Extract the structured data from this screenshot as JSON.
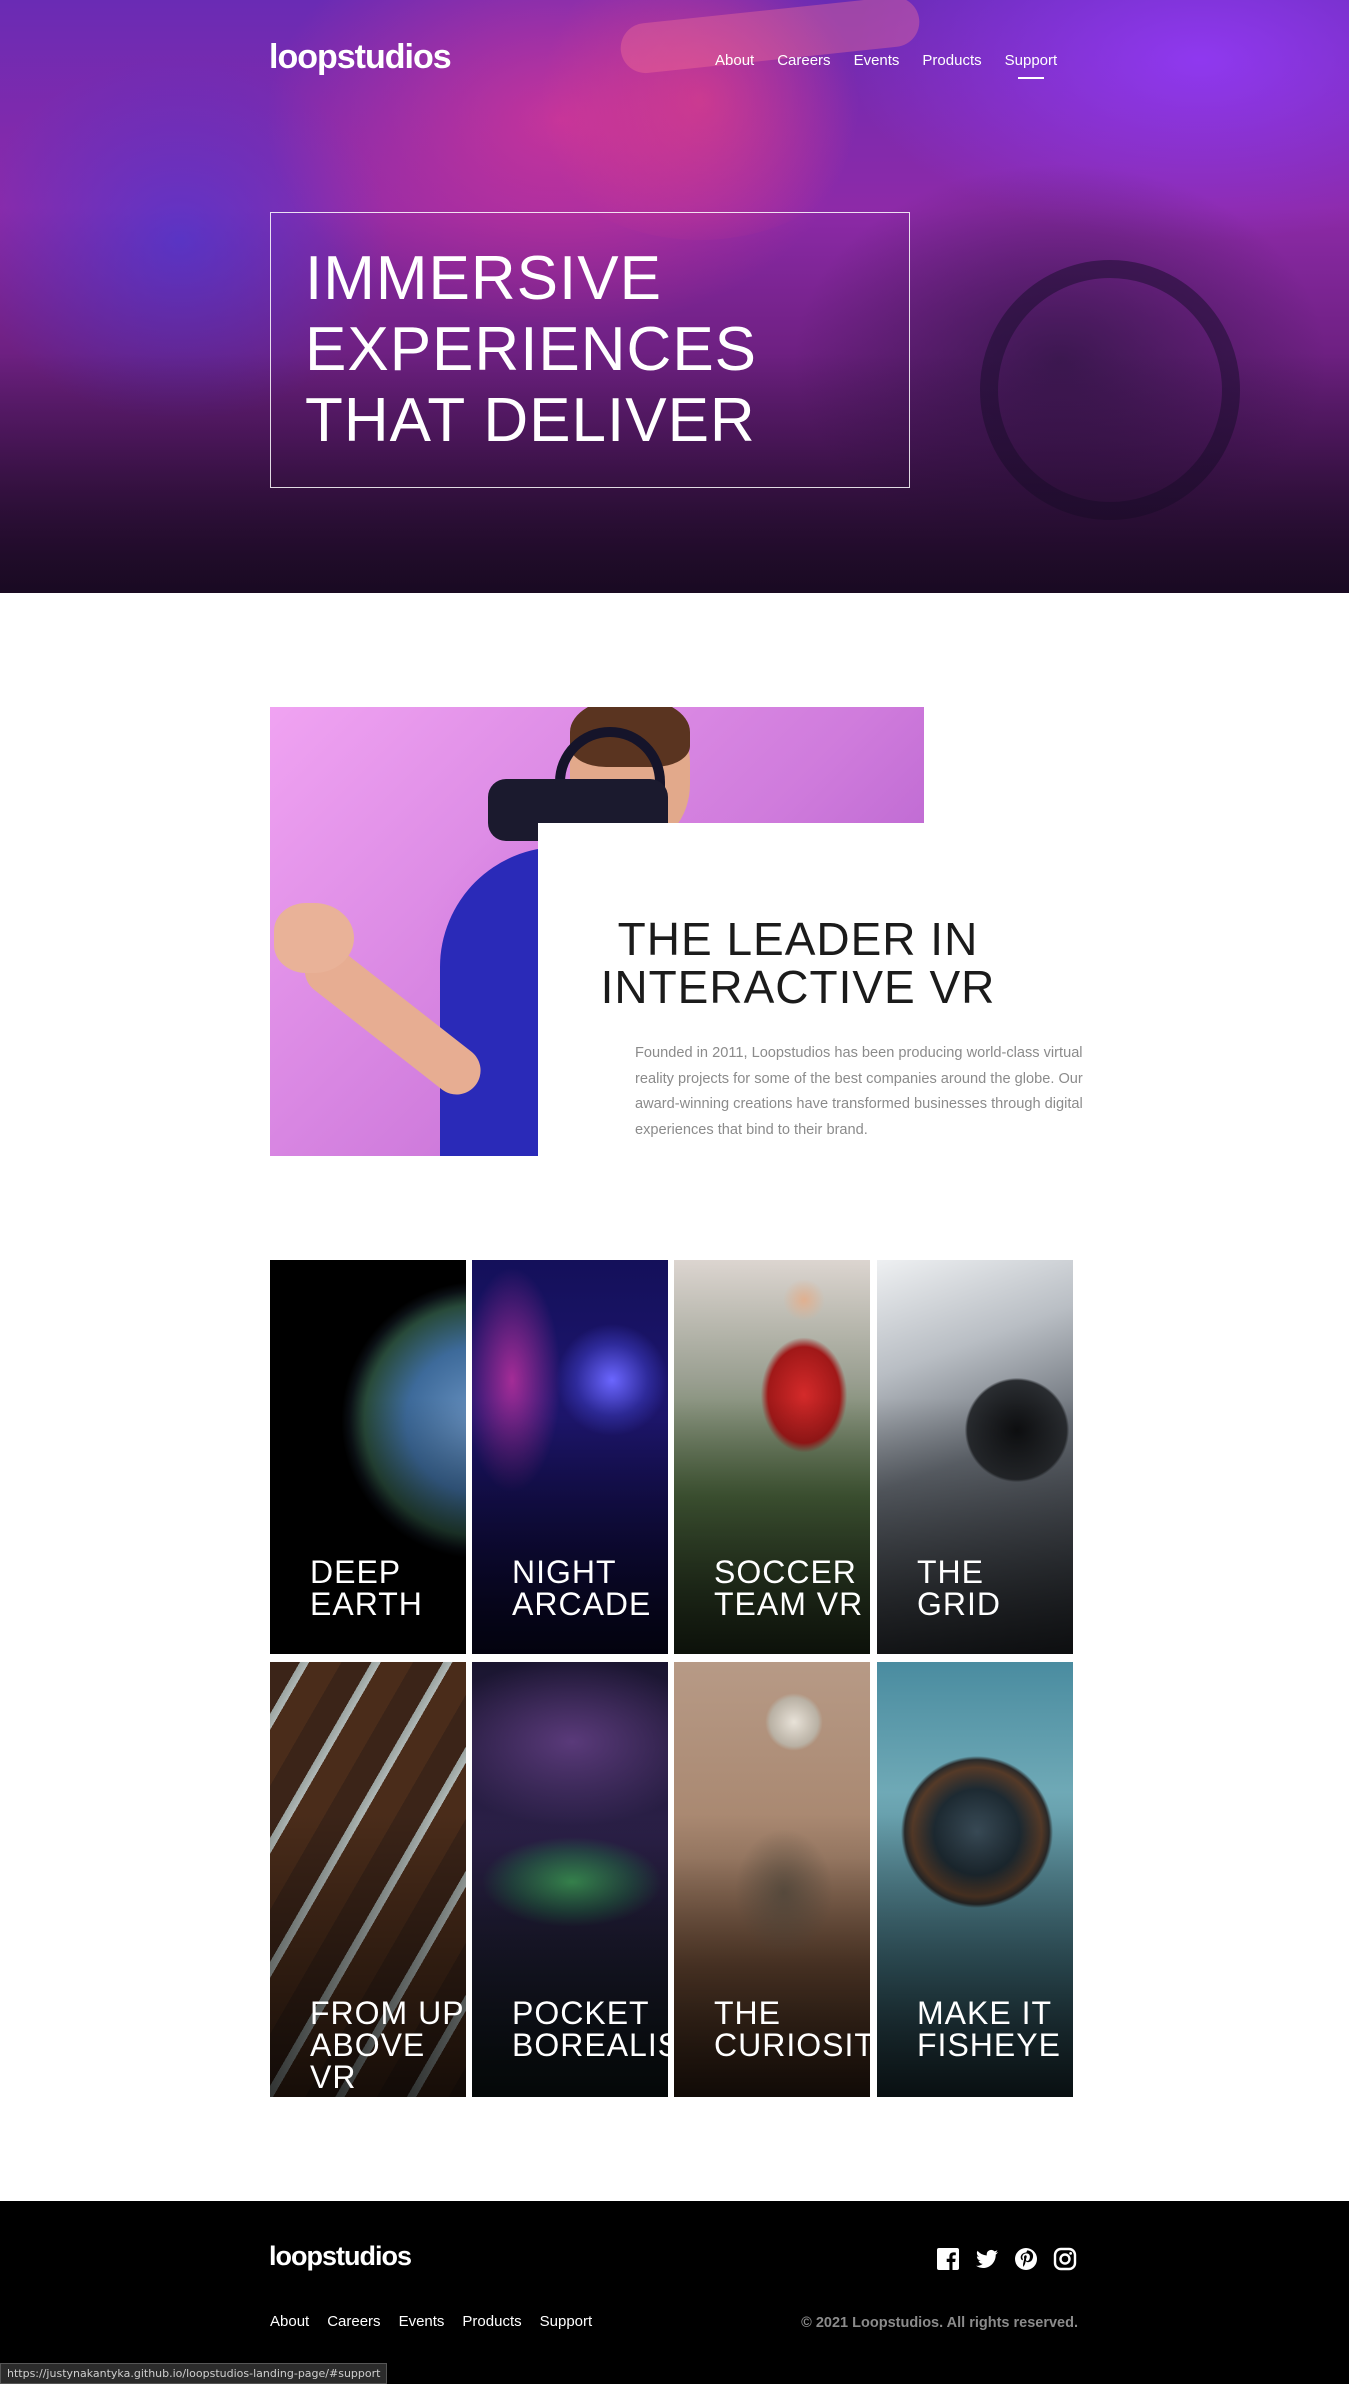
{
  "header": {
    "logo": "loopstudios",
    "nav": [
      "About",
      "Careers",
      "Events",
      "Products",
      "Support"
    ],
    "active_nav": "Support"
  },
  "hero": {
    "headline": [
      "IMMERSIVE",
      "EXPERIENCES",
      "THAT DELIVER"
    ]
  },
  "intro": {
    "heading": [
      "THE LEADER IN",
      "INTERACTIVE VR"
    ],
    "body": "Founded in 2011, Loopstudios has been producing world-class virtual reality projects for some of the best companies around the globe. Our award-winning creations have transformed businesses through digital experiences that bind to their brand."
  },
  "creations": [
    {
      "title": [
        "DEEP",
        "EARTH"
      ]
    },
    {
      "title": [
        "NIGHT",
        "ARCADE"
      ]
    },
    {
      "title": [
        "SOCCER",
        "TEAM VR"
      ]
    },
    {
      "title": [
        "THE",
        "GRID"
      ]
    },
    {
      "title": [
        "FROM UP",
        "ABOVE",
        "VR"
      ]
    },
    {
      "title": [
        "POCKET",
        "BOREALIS"
      ]
    },
    {
      "title": [
        "THE",
        "CURIOSITY"
      ]
    },
    {
      "title": [
        "MAKE IT",
        "FISHEYE"
      ]
    }
  ],
  "footer": {
    "logo": "loopstudios",
    "nav": [
      "About",
      "Careers",
      "Events",
      "Products",
      "Support"
    ],
    "social": [
      "facebook-icon",
      "twitter-icon",
      "pinterest-icon",
      "instagram-icon"
    ],
    "copyright": "© 2021 Loopstudios. All rights reserved."
  },
  "status_url": "https://justynakantyka.github.io/loopstudios-landing-page/#support",
  "colors": {
    "background": "#ffffff",
    "footer": "#000000",
    "text_muted": "#8b8b8b"
  }
}
